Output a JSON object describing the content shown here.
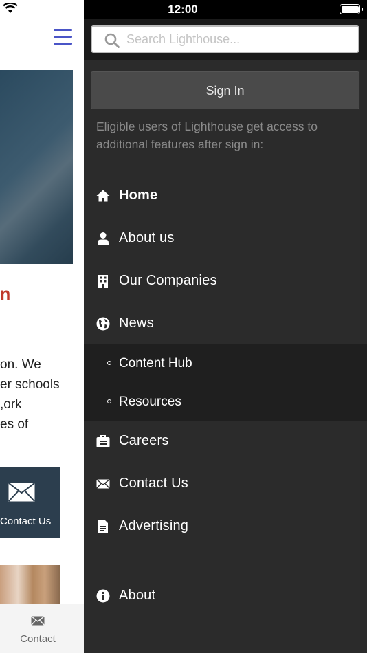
{
  "status_bar": {
    "time": "12:00"
  },
  "background_page": {
    "hero_heading_fragment": "n",
    "paragraph_lines": [
      "on. We",
      "er schools",
      "ork,",
      "es of"
    ],
    "contact_button_label": "Contact Us",
    "tab_bar": {
      "contact_label": "Contact"
    },
    "colors": {
      "hamburger": "#4a55c7",
      "heading": "#c0392b",
      "contact_box": "#2c3e4e"
    }
  },
  "drawer": {
    "search": {
      "placeholder": "Search Lighthouse...",
      "value": ""
    },
    "sign_in_label": "Sign In",
    "sign_in_note": "Eligible users of Lighthouse get access to additional features after sign in:",
    "menu": [
      {
        "label": "Home",
        "icon": "home-icon",
        "active": true
      },
      {
        "label": "About us",
        "icon": "person-icon"
      },
      {
        "label": "Our Companies",
        "icon": "building-icon"
      },
      {
        "label": "News",
        "icon": "globe-icon"
      },
      {
        "label": "Careers",
        "icon": "briefcase-icon"
      },
      {
        "label": "Contact Us",
        "icon": "envelope-icon"
      },
      {
        "label": "Advertising",
        "icon": "document-icon"
      },
      {
        "label": "About",
        "icon": "info-icon"
      }
    ],
    "news_submenu": [
      {
        "label": "Content Hub"
      },
      {
        "label": "Resources"
      }
    ],
    "colors": {
      "background": "#2b2b2b",
      "submenu_background": "#1f1f1f",
      "text": "#ffffff",
      "note_text": "#8a8a8a"
    }
  }
}
